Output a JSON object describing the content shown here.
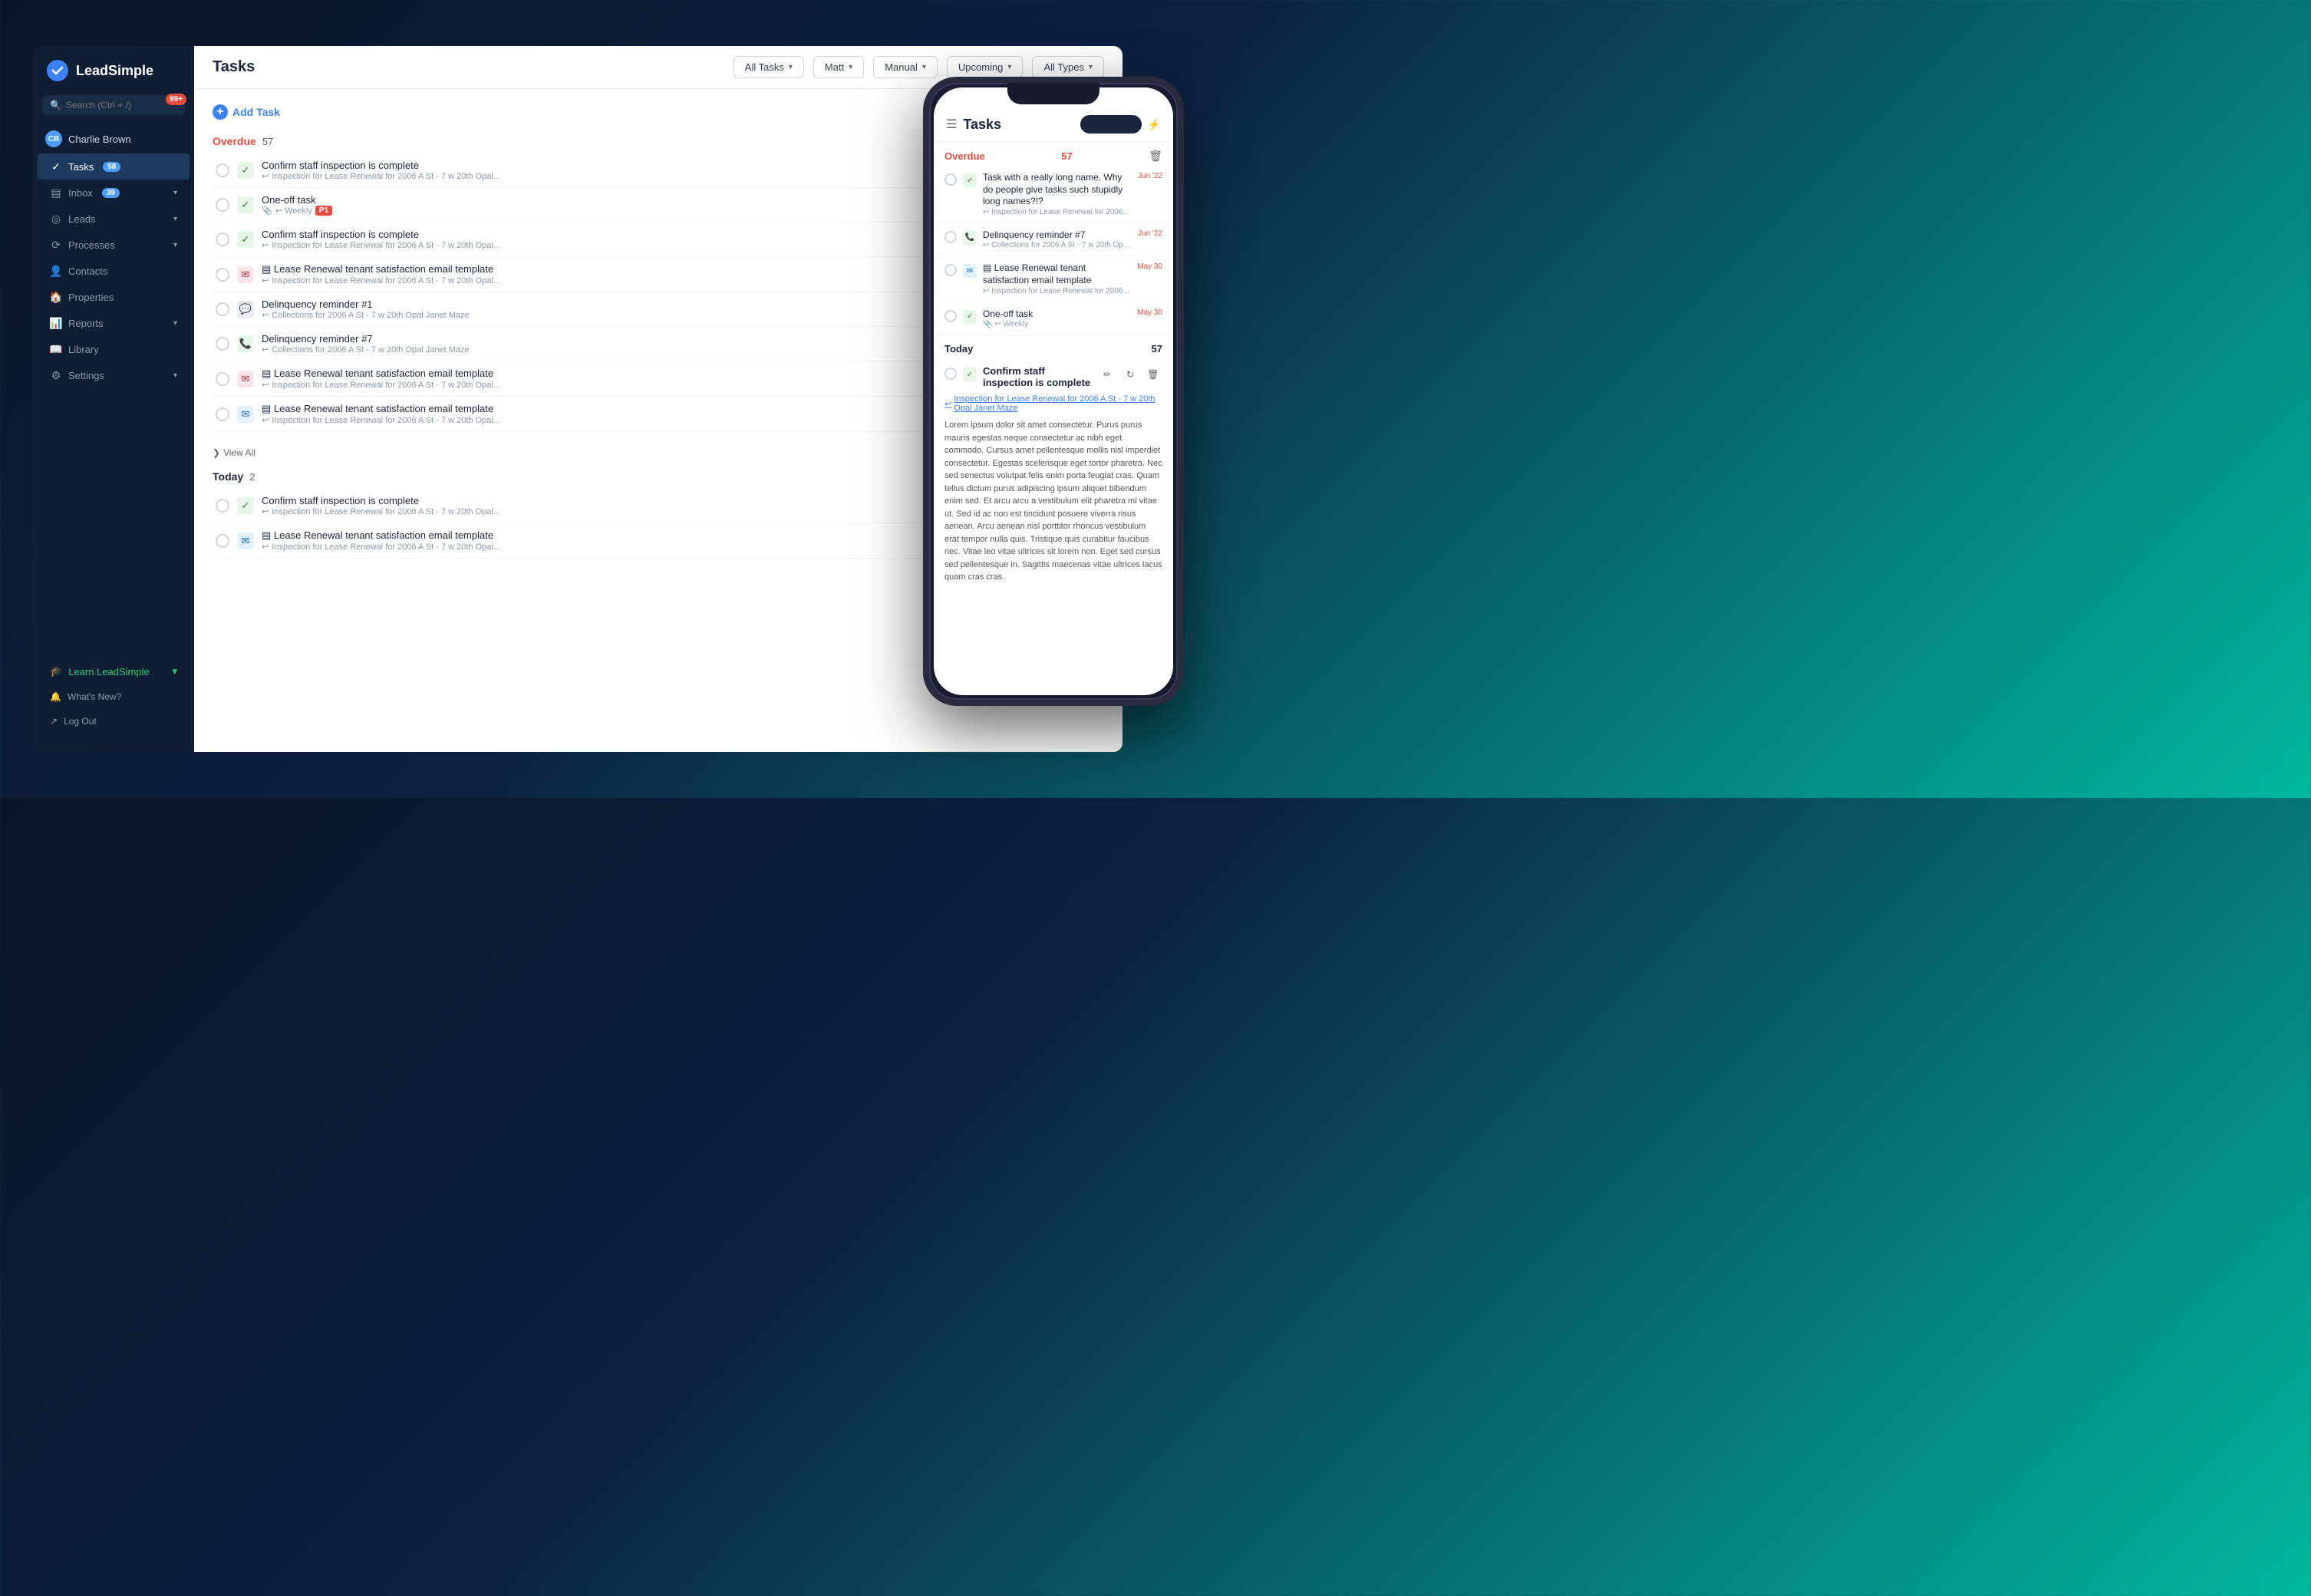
{
  "app": {
    "name": "LeadSimple"
  },
  "sidebar": {
    "search_placeholder": "Search (Ctrl + /)",
    "notification_count": "99+",
    "user": {
      "name": "Charlie Brown"
    },
    "nav_items": [
      {
        "id": "tasks",
        "label": "Tasks",
        "badge": "58",
        "active": true,
        "icon": "✓"
      },
      {
        "id": "inbox",
        "label": "Inbox",
        "badge": "39",
        "active": false,
        "icon": "▤",
        "has_chevron": true
      },
      {
        "id": "leads",
        "label": "Leads",
        "active": false,
        "icon": "◎",
        "has_chevron": true
      },
      {
        "id": "processes",
        "label": "Processes",
        "active": false,
        "icon": "⟳",
        "has_chevron": true
      },
      {
        "id": "contacts",
        "label": "Contacts",
        "active": false,
        "icon": "👤"
      },
      {
        "id": "properties",
        "label": "Properties",
        "active": false,
        "icon": "🏠"
      },
      {
        "id": "reports",
        "label": "Reports",
        "active": false,
        "icon": "📊",
        "has_chevron": true
      },
      {
        "id": "library",
        "label": "Library",
        "active": false,
        "icon": "📖"
      },
      {
        "id": "settings",
        "label": "Settings",
        "active": false,
        "icon": "⚙",
        "has_chevron": true
      }
    ],
    "bottom_items": [
      {
        "id": "whats-new",
        "label": "What's New?",
        "icon": "🔔"
      },
      {
        "id": "logout",
        "label": "Log Out",
        "icon": "↗"
      }
    ],
    "learn_label": "Learn LeadSimple"
  },
  "main": {
    "title": "Tasks",
    "filters": [
      {
        "label": "All Tasks",
        "id": "all-tasks"
      },
      {
        "label": "Matt",
        "id": "matt"
      },
      {
        "label": "Manual",
        "id": "manual"
      },
      {
        "label": "Upcoming",
        "id": "upcoming"
      },
      {
        "label": "All Types",
        "id": "all-types"
      }
    ],
    "add_task_label": "Add Task",
    "overdue_section": {
      "title": "Overdue",
      "count": "57",
      "tasks": [
        {
          "name": "Confirm staff inspection is complete",
          "sub": "Inspection for Lease Renewal for 2006 A St - 7 w 20th Opal...",
          "type": "check"
        },
        {
          "name": "One-off task",
          "sub": "Weekly  🚩 P1",
          "type": "check",
          "has_tag": true
        },
        {
          "name": "Confirm staff inspection is complete",
          "sub": "Inspection for Lease Renewal for 2006 A St - 7 w 20th Opal...",
          "type": "check"
        },
        {
          "name": "Lease Renewal tenant satisfaction email template",
          "sub": "Inspection for Lease Renewal for 2006 A St - 7 w 20th Opal...",
          "type": "email"
        },
        {
          "name": "Delinquency reminder #1",
          "sub": "Collections for 2006 A St - 7 w 20th Opal Janet Maze",
          "type": "msg"
        },
        {
          "name": "Delinquency reminder #7",
          "sub": "Collections for 2006 A St - 7 w 20th Opal Janet Maze",
          "type": "phone"
        },
        {
          "name": "Lease Renewal tenant satisfaction email template",
          "sub": "Inspection for Lease Renewal for 2006 A St - 7 w 20th Opal...",
          "type": "email-red"
        },
        {
          "name": "Lease Renewal tenant satisfaction email template",
          "sub": "Inspection for Lease Renewal for 2006 A St - 7 w 20th Opal...",
          "type": "email-blue"
        }
      ],
      "view_all_label": "View All"
    },
    "today_section": {
      "title": "Today",
      "count": "2",
      "tasks": [
        {
          "name": "Confirm staff inspection is complete",
          "sub": "Inspection for Lease Renewal for 2006 A St - 7 w 20th Opal...",
          "type": "check"
        },
        {
          "name": "Lease Renewal tenant satisfaction email template",
          "sub": "Inspection for Lease Renewal for 2006 A St - 7 w 20th Opal...",
          "type": "email-blue"
        }
      ]
    }
  },
  "phone": {
    "title": "Tasks",
    "overdue_section": {
      "title": "Overdue",
      "count": "57",
      "tasks": [
        {
          "name": "Task with a really long name. Why do people give tasks such stupidly long names?!?",
          "sub": "Inspection for Lease Renewal for 2006 A St...",
          "date": "Jun '22",
          "type": "check"
        },
        {
          "name": "Delinquency reminder #7",
          "sub": "Collections for 2006 A St - 7 w 20th Opal J...",
          "date": "Jun '22",
          "type": "phone"
        },
        {
          "name": "Lease Renewal tenant satisfaction email template",
          "sub": "Inspection for Lease Renewal for 2006 A St...",
          "date": "May 30",
          "type": "email-blue"
        },
        {
          "name": "One-off task",
          "sub": "Weekly",
          "date": "May 30",
          "type": "check"
        }
      ]
    },
    "today_section": {
      "title": "Today",
      "count": "57"
    },
    "expanded_task": {
      "name": "Confirm staff inspection is complete",
      "link": "Inspection for Lease Renewal for 2006 A St - 7 w 20th Opal Janet Maze",
      "lorem": "Lorem ipsum dolor sit amet consectetur. Purus purus mauris egestas neque consectetur ac nibh eget commodo. Cursus amet pellentesque mollis nisl imperdiet consectetur. Egestas scelerisque eget tortor pharetra. Nec sed senectus volutpat felis enim porta feugiat cras. Quam tellus dictum purus adipiscing ipsum aliquet bibendum enim sed. Et arcu arcu a vestibulum elit pharetra mi vitae ut. Sed id ac non est tincidunt posuere viverra risus aenean. Arcu aenean nisl porttitor rhoncus vestibulum erat tempor nulla quis. Tristique quis curabitur faucibus nec. Vitae leo vitae ultrices sit lorem non. Eget sed cursus sed pellentesque in. Sagittis maecenas vitae ultrices lacus quam cras cras."
    }
  }
}
